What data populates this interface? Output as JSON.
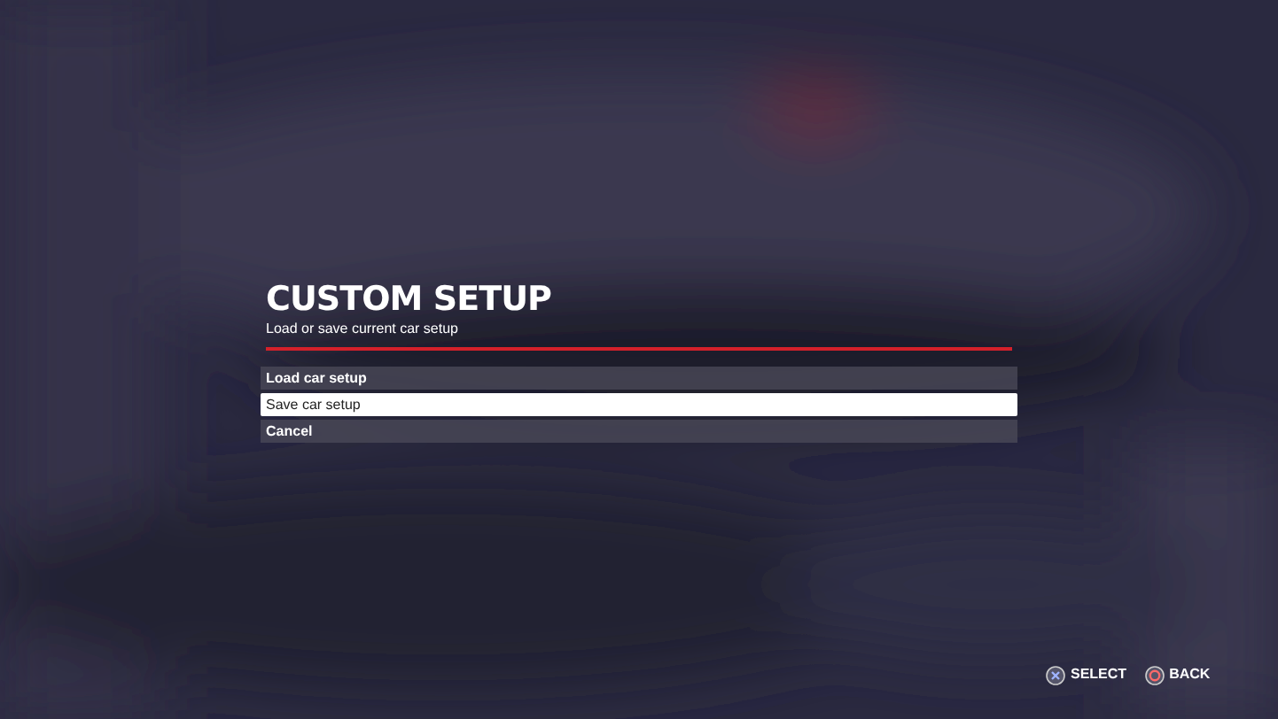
{
  "menu": {
    "title": "CUSTOM SETUP",
    "subtitle": "Load or save current car setup",
    "items": [
      {
        "label": "Load car setup",
        "selected": false
      },
      {
        "label": "Save car setup",
        "selected": true
      },
      {
        "label": "Cancel",
        "selected": false
      }
    ]
  },
  "prompts": [
    {
      "kind": "cross",
      "label": "SELECT"
    },
    {
      "kind": "circle",
      "label": "BACK"
    }
  ]
}
